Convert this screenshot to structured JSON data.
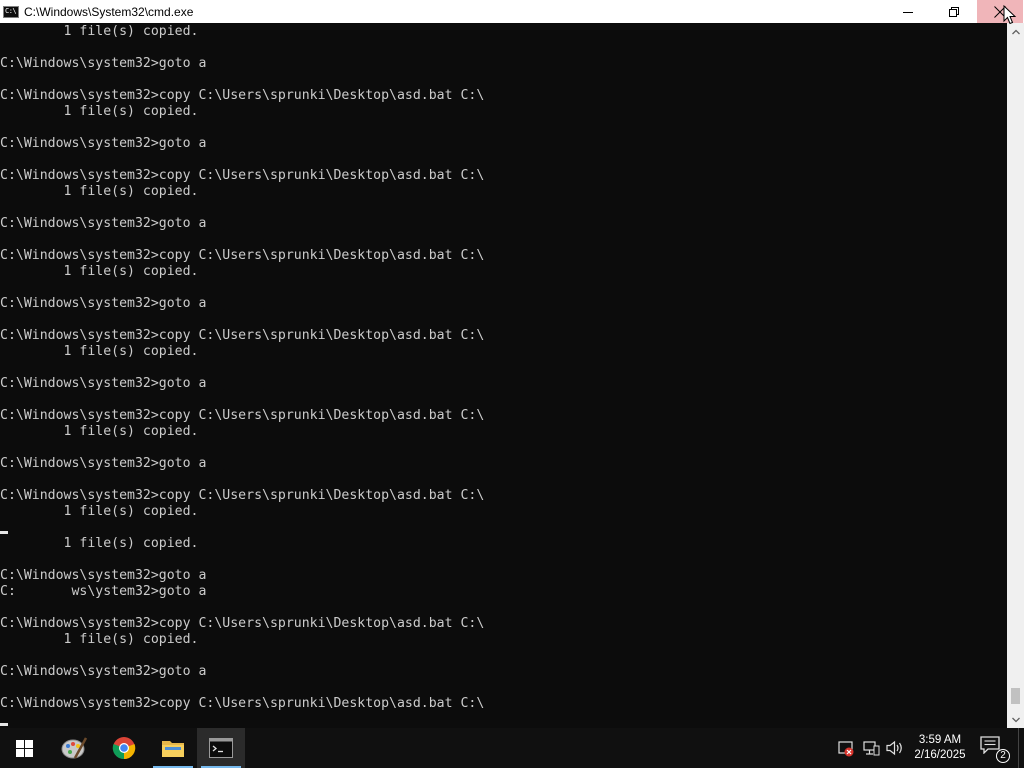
{
  "window": {
    "title": "C:\\Windows\\System32\\cmd.exe",
    "minimize_label": "Minimize",
    "maximize_label": "Restore Down",
    "close_label": "Close"
  },
  "console": {
    "lines": [
      "        1 file(s) copied.",
      "",
      "C:\\Windows\\system32>goto a",
      "",
      "C:\\Windows\\system32>copy C:\\Users\\sprunki\\Desktop\\asd.bat C:\\",
      "        1 file(s) copied.",
      "",
      "C:\\Windows\\system32>goto a",
      "",
      "C:\\Windows\\system32>copy C:\\Users\\sprunki\\Desktop\\asd.bat C:\\",
      "        1 file(s) copied.",
      "",
      "C:\\Windows\\system32>goto a",
      "",
      "C:\\Windows\\system32>copy C:\\Users\\sprunki\\Desktop\\asd.bat C:\\",
      "        1 file(s) copied.",
      "",
      "C:\\Windows\\system32>goto a",
      "",
      "C:\\Windows\\system32>copy C:\\Users\\sprunki\\Desktop\\asd.bat C:\\",
      "        1 file(s) copied.",
      "",
      "C:\\Windows\\system32>goto a",
      "",
      "C:\\Windows\\system32>copy C:\\Users\\sprunki\\Desktop\\asd.bat C:\\",
      "        1 file(s) copied.",
      "",
      "C:\\Windows\\system32>goto a",
      "",
      "C:\\Windows\\system32>copy C:\\Users\\sprunki\\Desktop\\asd.bat C:\\",
      "        1 file(s) copied.",
      "",
      "        1 file(s) copied.",
      "",
      "C:\\Windows\\system32>goto a",
      "C:       ws\\ystem32>goto a",
      "",
      "C:\\Windows\\system32>copy C:\\Users\\sprunki\\Desktop\\asd.bat C:\\",
      "        1 file(s) copied.",
      "",
      "C:\\Windows\\system32>goto a",
      "",
      "C:\\Windows\\system32>copy C:\\Users\\sprunki\\Desktop\\asd.bat C:\\",
      ""
    ],
    "text_color": "#cccccc",
    "background": "#0c0c0c"
  },
  "scrollbar": {
    "position_fraction": 0.99
  },
  "taskbar": {
    "items": [
      {
        "name": "start-button",
        "icon": "windows-logo-icon",
        "label": "Start"
      },
      {
        "name": "paint-app",
        "icon": "paint-palette-icon",
        "label": "Paint"
      },
      {
        "name": "chrome-app",
        "icon": "chrome-icon",
        "label": "Google Chrome"
      },
      {
        "name": "file-explorer-app",
        "icon": "folder-icon",
        "label": "File Explorer"
      },
      {
        "name": "cmd-app",
        "icon": "command-prompt-icon",
        "label": "Command Prompt"
      }
    ],
    "tray": {
      "icons": [
        "security-alert-icon",
        "network-icon",
        "volume-icon"
      ],
      "time": "3:59 AM",
      "date": "2/16/2025",
      "notification_count": "2"
    },
    "accent": "#76b9ed"
  }
}
